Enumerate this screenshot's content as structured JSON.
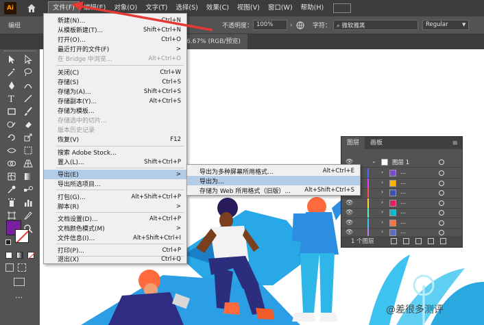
{
  "app": {
    "logo_text": "Ai"
  },
  "menubar": {
    "items": [
      "文件(F)",
      "编辑(E)",
      "对象(O)",
      "文字(T)",
      "选择(S)",
      "效果(C)",
      "视图(V)",
      "窗口(W)",
      "帮助(H)"
    ]
  },
  "controlbar": {
    "left_label": "编组",
    "opacity_label": "不透明度：",
    "opacity_value": "100%",
    "char_label": "字符：",
    "font_value": "微软雅黑",
    "weight_value": "Regular"
  },
  "tab": {
    "title": "6.67% (RGB/预览)"
  },
  "file_menu": {
    "items": [
      {
        "label": "新建(N)...",
        "shortcut": "Ctrl+N"
      },
      {
        "label": "从模板新建(T)...",
        "shortcut": "Shift+Ctrl+N"
      },
      {
        "label": "打开(O)...",
        "shortcut": "Ctrl+O"
      },
      {
        "label": "最近打开的文件(F)",
        "shortcut": ">"
      },
      {
        "label": "在 Bridge 中浏览...",
        "shortcut": "Alt+Ctrl+O"
      },
      {
        "label": "关闭(C)",
        "shortcut": "Ctrl+W"
      },
      {
        "label": "存储(S)",
        "shortcut": "Ctrl+S"
      },
      {
        "label": "存储为(A)...",
        "shortcut": "Shift+Ctrl+S"
      },
      {
        "label": "存储副本(Y)...",
        "shortcut": "Alt+Ctrl+S"
      },
      {
        "label": "存储为模板...",
        "shortcut": ""
      },
      {
        "label": "存储选中的切片...",
        "shortcut": ""
      },
      {
        "label": "版本历史记录",
        "shortcut": ""
      },
      {
        "label": "恢复(V)",
        "shortcut": "F12"
      },
      {
        "label": "搜索 Adobe Stock...",
        "shortcut": ""
      },
      {
        "label": "置入(L)...",
        "shortcut": "Shift+Ctrl+P"
      },
      {
        "label": "导出(E)",
        "shortcut": ">"
      },
      {
        "label": "导出所选项目...",
        "shortcut": ""
      },
      {
        "label": "打包(G)...",
        "shortcut": "Alt+Shift+Ctrl+P"
      },
      {
        "label": "脚本(R)",
        "shortcut": ">"
      },
      {
        "label": "文档设置(D)...",
        "shortcut": "Alt+Ctrl+P"
      },
      {
        "label": "文档颜色模式(M)",
        "shortcut": ">"
      },
      {
        "label": "文件信息(I)...",
        "shortcut": "Alt+Shift+Ctrl+I"
      },
      {
        "label": "打印(P)...",
        "shortcut": "Ctrl+P"
      },
      {
        "label": "退出(X)",
        "shortcut": "Ctrl+Q"
      }
    ]
  },
  "export_submenu": {
    "items": [
      {
        "label": "导出为多种屏幕所用格式...",
        "shortcut": "Alt+Ctrl+E"
      },
      {
        "label": "导出为...",
        "shortcut": ""
      },
      {
        "label": "存储为 Web 所用格式（旧版）...",
        "shortcut": "Alt+Shift+Ctrl+S"
      }
    ]
  },
  "layers_panel": {
    "tabs": [
      "图层",
      "画板"
    ],
    "top_layer": "图层 1",
    "sublayer_dots": "...",
    "footer": "1 个图层"
  },
  "watermark": "@差很多测评",
  "colors": {
    "accent_red": "#e53935",
    "fill_swatch": "#7b1fa2",
    "menu_highlight": "#b3cde8"
  }
}
